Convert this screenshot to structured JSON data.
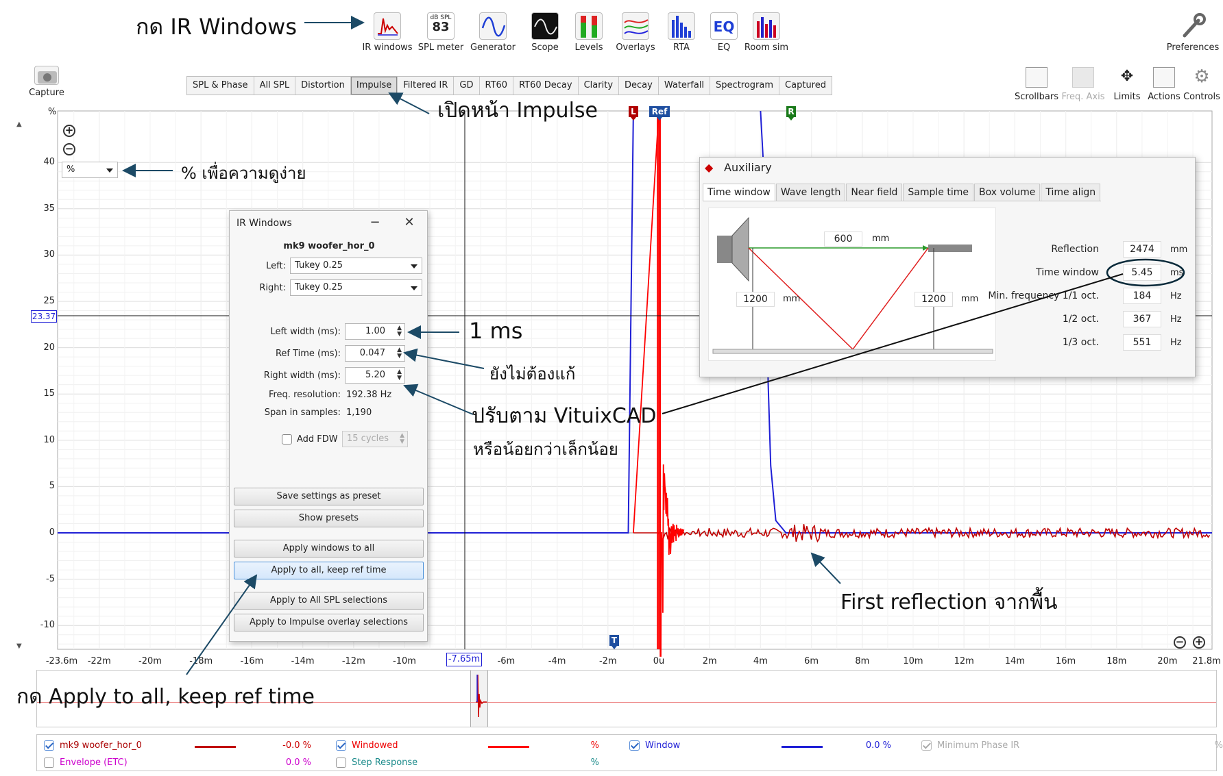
{
  "toolbar": {
    "items": [
      {
        "label": "IR windows",
        "icon": "ir-windows-icon"
      },
      {
        "label": "SPL meter",
        "icon": "spl-meter-icon",
        "badge_top": "dB SPL",
        "badge_value": "83"
      },
      {
        "label": "Generator",
        "icon": "generator-icon"
      },
      {
        "label": "Scope",
        "icon": "scope-icon"
      },
      {
        "label": "Levels",
        "icon": "levels-icon"
      },
      {
        "label": "Overlays",
        "icon": "overlays-icon"
      },
      {
        "label": "RTA",
        "icon": "rta-icon"
      },
      {
        "label": "EQ",
        "icon": "eq-icon"
      },
      {
        "label": "Room sim",
        "icon": "room-sim-icon"
      }
    ],
    "preferences": "Preferences",
    "capture": "Capture"
  },
  "tabs": [
    "SPL & Phase",
    "All SPL",
    "Distortion",
    "Impulse",
    "Filtered IR",
    "GD",
    "RT60",
    "RT60 Decay",
    "Clarity",
    "Decay",
    "Waterfall",
    "Spectrogram",
    "Captured"
  ],
  "active_tab": "Impulse",
  "right_tools": [
    "Scrollbars",
    "Freq. Axis",
    "Limits",
    "Actions",
    "Controls"
  ],
  "plot": {
    "y_unit": "%",
    "unit_select": "%",
    "cursor_y": "23.37",
    "cursor_x": "-7.65m",
    "y_ticks": [
      "40",
      "35",
      "30",
      "25",
      "20",
      "15",
      "10",
      "5",
      "0",
      "-5",
      "-10"
    ],
    "x_ticks": [
      "-23.6m",
      "-22m",
      "-20m",
      "-18m",
      "-16m",
      "-14m",
      "-12m",
      "-10m",
      "-6m",
      "-4m",
      "-2m",
      "0u",
      "2m",
      "4m",
      "6m",
      "8m",
      "10m",
      "12m",
      "14m",
      "16m",
      "18m",
      "20m",
      "21.8m"
    ],
    "markers": {
      "left": "L",
      "ref": "Ref",
      "right": "R",
      "t": "T"
    },
    "colors": {
      "window": "#1f1fd6",
      "windowed": "#ff0000",
      "impulse": "#c00000"
    }
  },
  "annotations": {
    "press_ir": "กด IR Windows",
    "open_impulse": "เปิดหน้า Impulse",
    "percent_note": "% เพื่อความดูง่าย",
    "one_ms": "1 ms",
    "no_change": "ยังไม่ต้องแก้",
    "adjust_vituix_1": "ปรับตาม VituixCAD",
    "adjust_vituix_2": "หรือน้อยกว่าเล็กน้อย",
    "first_reflection": "First reflection จากพื้น",
    "press_apply": "กด Apply to all, keep ref time"
  },
  "ir_dialog": {
    "title": "IR Windows",
    "measurement": "mk9 woofer_hor_0",
    "left_label": "Left:",
    "left_value": "Tukey 0.25",
    "right_label": "Right:",
    "right_value": "Tukey 0.25",
    "left_width_label": "Left width (ms):",
    "left_width": "1.00",
    "ref_time_label": "Ref Time (ms):",
    "ref_time": "0.047",
    "right_width_label": "Right width (ms):",
    "right_width": "5.20",
    "freq_res_label": "Freq. resolution:",
    "freq_res": "192.38 Hz",
    "span_label": "Span in samples:",
    "span": "1,190",
    "fdw_label": "Add FDW",
    "fdw_value": "15 cycles",
    "buttons": [
      "Save settings as preset",
      "Show presets",
      "Apply windows to all",
      "Apply to all, keep ref time",
      "Apply to All SPL selections",
      "Apply to Impulse overlay selections"
    ]
  },
  "aux": {
    "title": "Auxiliary",
    "tabs": [
      "Time window",
      "Wave length",
      "Near field",
      "Sample time",
      "Box volume",
      "Time align"
    ],
    "distance": "600",
    "height_left": "1200",
    "height_right": "1200",
    "mm": "mm",
    "rows": [
      {
        "label": "Reflection",
        "value": "2474",
        "unit": "mm"
      },
      {
        "label": "Time window",
        "value": "5.45",
        "unit": "ms"
      },
      {
        "label": "Min. frequency 1/1 oct.",
        "value": "184",
        "unit": "Hz"
      },
      {
        "label": "1/2 oct.",
        "value": "367",
        "unit": "Hz"
      },
      {
        "label": "1/3 oct.",
        "value": "551",
        "unit": "Hz"
      }
    ]
  },
  "legend": [
    {
      "label": "mk9 woofer_hor_0",
      "value": "-0.0 %",
      "color": "#c00000",
      "checked": true
    },
    {
      "label": "Windowed",
      "value": "%",
      "color": "#ff0000",
      "checked": true
    },
    {
      "label": "Window",
      "value": "0.0 %",
      "color": "#1f1fd6",
      "checked": true
    },
    {
      "label": "Minimum Phase IR",
      "value": "%",
      "color": "#aaaaaa",
      "checked": true
    },
    {
      "label": "Envelope (ETC)",
      "value": "0.0 %",
      "color": "#cc00cc",
      "checked": false
    },
    {
      "label": "Step Response",
      "value": "%",
      "color": "#1a8a8a",
      "checked": false
    }
  ]
}
